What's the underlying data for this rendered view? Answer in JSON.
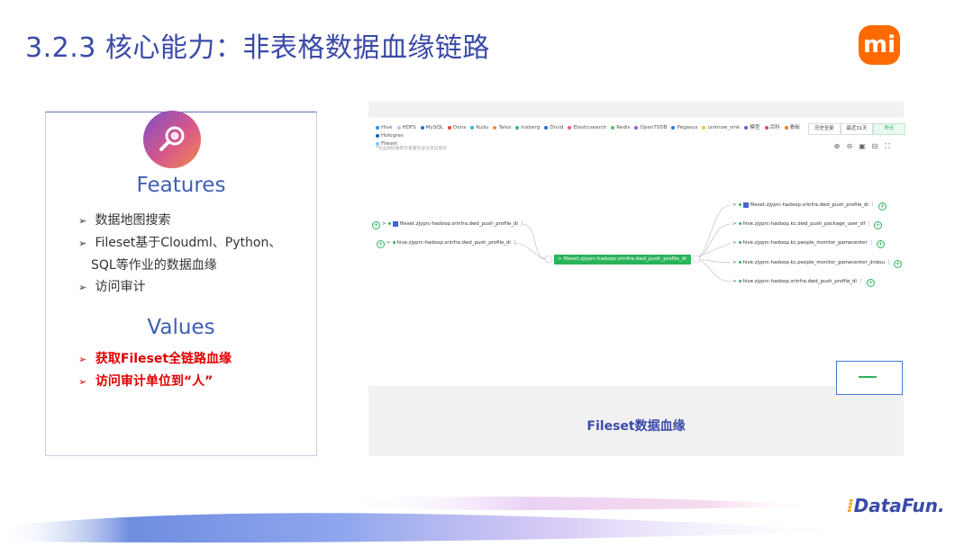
{
  "slide_title": "3.2.3 核心能力：非表格数据血缘链路",
  "brand": {
    "logo_text": "mi",
    "logo_color": "#ff6a00",
    "footer_brand_a": "Data",
    "footer_brand_b": "Fun."
  },
  "card": {
    "icon": "search-icon",
    "features_heading": "Features",
    "features": [
      {
        "line1": "数据地图搜索"
      },
      {
        "line1": "Fileset基于Cloudml、Python、",
        "line2": "SQL等作业的数据血缘"
      },
      {
        "line1": "访问审计"
      }
    ],
    "values_heading": "Values",
    "values": [
      "获取Fileset全链路血缘",
      "访问审计单位到“人”"
    ]
  },
  "screenshot": {
    "legend": [
      {
        "label": "Hive",
        "color": "#2d8cf0"
      },
      {
        "label": "HDFS",
        "color": "#a6c8f5"
      },
      {
        "label": "MySQL",
        "color": "#1f6fd6"
      },
      {
        "label": "Doris",
        "color": "#e64545"
      },
      {
        "label": "Kudu",
        "color": "#38b8c8"
      },
      {
        "label": "Talos",
        "color": "#f28b30"
      },
      {
        "label": "Iceberg",
        "color": "#38b86a"
      },
      {
        "label": "Druid",
        "color": "#3366cc"
      },
      {
        "label": "Elasticsearch",
        "color": "#e65a8c"
      },
      {
        "label": "Redis",
        "color": "#58c46a"
      },
      {
        "label": "OpenTSDB",
        "color": "#9a5de0"
      },
      {
        "label": "Pegasus",
        "color": "#2a7ad8"
      },
      {
        "label": "unknow_sink",
        "color": "#f5c242"
      },
      {
        "label": "模型",
        "color": "#6a5acd"
      },
      {
        "label": "百科",
        "color": "#e0455a"
      },
      {
        "label": "看板",
        "color": "#e67e22"
      },
      {
        "label": "Hologres",
        "color": "#1f5fbf"
      },
      {
        "label": "Fileset",
        "color": "#7ac7f0"
      }
    ],
    "tabs": [
      "历史全部",
      "最近31天",
      "昨天"
    ],
    "active_tab": "昨天",
    "hint": "*点击鼠标悬停可查看作业任务信息id",
    "left_nodes": [
      {
        "label": "fileset.zjyprc-hadoop.srinfra.dwd_push_profile_di",
        "type": "fileset"
      },
      {
        "label": "hive.zjyprc-hadoop.srinfra.dwd_push_profile_di",
        "type": "hive"
      }
    ],
    "center_node": "fileset.zjyprc-hadoop.srinfra.dwd_push_profile_di",
    "right_nodes": [
      {
        "label": "fileset.zjyprc-hadoop.srinfra.dwd_push_profile_di",
        "type": "fileset"
      },
      {
        "label": "hive.zjyprc-hadoop.kc.dwd_push_package_user_df",
        "type": "hive"
      },
      {
        "label": "hive.zjyprc-hadoop.kc.people_monitor_gamecenter",
        "type": "hive"
      },
      {
        "label": "hive.zjyprc-hadoop.kc.people_monitor_gamecenter_jindou",
        "type": "hive"
      },
      {
        "label": "hive.zjyprc-hadoop.srinfra.dwd_push_profile_di",
        "type": "hive"
      }
    ],
    "caption": "Fileset数据血缘"
  }
}
